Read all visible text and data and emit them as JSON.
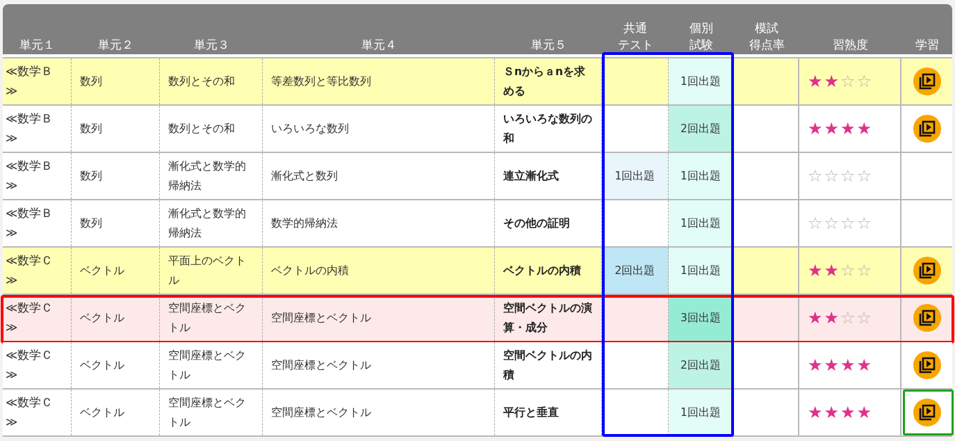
{
  "columns": [
    {
      "lines": [
        "単元１"
      ],
      "framed": false
    },
    {
      "lines": [
        "単元２"
      ],
      "framed": false
    },
    {
      "lines": [
        "単元３"
      ],
      "framed": false
    },
    {
      "lines": [
        "単元４"
      ],
      "framed": false
    },
    {
      "lines": [
        "単元５"
      ],
      "framed": false
    },
    {
      "lines": [
        "共通",
        "テスト"
      ],
      "framed": true
    },
    {
      "lines": [
        "個別",
        "試験"
      ],
      "framed": true
    },
    {
      "lines": [
        "模試",
        "得点率"
      ],
      "framed": false
    },
    {
      "lines": [
        "習熟度"
      ],
      "framed": false
    },
    {
      "lines": [
        "学習"
      ],
      "framed": false
    }
  ],
  "rows": [
    {
      "color": "#ffffb3",
      "outlined": false,
      "units": [
        "≪数学Ｂ≫",
        "数列",
        "数列とその和",
        "等差数列と等比数列",
        "Ｓnからａnを求める"
      ],
      "exam": {
        "text": "1回出題",
        "color": "#e2fdf6"
      },
      "stars": 2,
      "video": true,
      "video_outlined": false
    },
    {
      "color": "#ffffff",
      "outlined": false,
      "units": [
        "≪数学Ｂ≫",
        "数列",
        "数列とその和",
        "いろいろな数列",
        "いろいろな数列の和"
      ],
      "exam": {
        "text": "2回出題",
        "color": "#bdf3e4"
      },
      "stars": 4,
      "video": true,
      "video_outlined": false
    },
    {
      "color": "#ffffff",
      "outlined": false,
      "units": [
        "≪数学Ｂ≫",
        "数列",
        "漸化式と数学的帰納法",
        "漸化式と数列",
        "連立漸化式"
      ],
      "common": {
        "text": "1回出題",
        "color": "#e8f5fb"
      },
      "exam": {
        "text": "1回出題",
        "color": "#e2fdf6"
      },
      "stars": 0,
      "video": false,
      "video_outlined": false
    },
    {
      "color": "#ffffff",
      "outlined": false,
      "units": [
        "≪数学Ｂ≫",
        "数列",
        "漸化式と数学的帰納法",
        "数学的帰納法",
        "その他の証明"
      ],
      "exam": {
        "text": "1回出題",
        "color": "#e2fdf6"
      },
      "stars": 0,
      "video": false,
      "video_outlined": false
    },
    {
      "color": "#ffffb3",
      "outlined": false,
      "units": [
        "≪数学Ｃ≫",
        "ベクトル",
        "平面上のベクトル",
        "ベクトルの内積",
        "ベクトルの内積"
      ],
      "common": {
        "text": "2回出題",
        "color": "#bfe6f5"
      },
      "exam": {
        "text": "1回出題",
        "color": "#e2fdf6"
      },
      "stars": 2,
      "video": true,
      "video_outlined": false
    },
    {
      "color": "#fde9e9",
      "outlined": true,
      "units": [
        "≪数学Ｃ≫",
        "ベクトル",
        "空間座標とベクトル",
        "空間座標とベクトル",
        "空間ベクトルの演算・成分"
      ],
      "exam": {
        "text": "3回出題",
        "color": "#95ecd5"
      },
      "stars": 2,
      "video": true,
      "video_outlined": false
    },
    {
      "color": "#ffffff",
      "outlined": false,
      "units": [
        "≪数学Ｃ≫",
        "ベクトル",
        "空間座標とベクトル",
        "空間座標とベクトル",
        "空間ベクトルの内積"
      ],
      "exam": {
        "text": "2回出題",
        "color": "#bdf3e4"
      },
      "stars": 4,
      "video": true,
      "video_outlined": false
    },
    {
      "color": "#ffffff",
      "outlined": false,
      "units": [
        "≪数学Ｃ≫",
        "ベクトル",
        "空間座標とベクトル",
        "空間座標とベクトル",
        "平行と垂直"
      ],
      "exam": {
        "text": "1回出題",
        "color": "#e2fdf6"
      },
      "stars": 4,
      "video": true,
      "video_outlined": true
    }
  ]
}
